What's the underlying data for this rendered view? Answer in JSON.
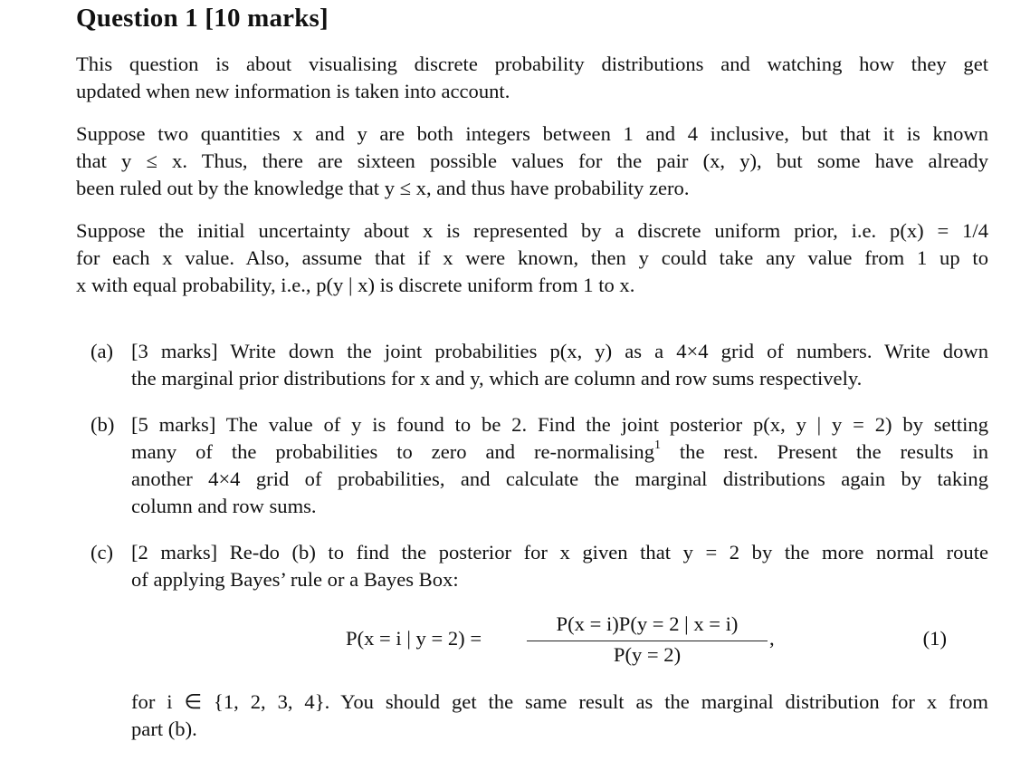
{
  "title": "Question 1 [10 marks]",
  "intro": {
    "lines": [
      "This question is about visualising discrete probability distributions and watching how they get",
      "updated when new information is taken into account."
    ]
  },
  "setup": {
    "lines": [
      "Suppose two quantities x and y are both integers between 1 and 4 inclusive, but that it is known",
      "that y ≤ x. Thus, there are sixteen possible values for the pair (x, y), but some have already",
      "been ruled out by the knowledge that y ≤ x, and thus have probability zero."
    ]
  },
  "prior": {
    "lines": [
      "Suppose the initial uncertainty about x is represented by a discrete uniform prior, i.e. p(x) = 1/4",
      "for each x value. Also, assume that if x were known, then y could take any value from 1 up to",
      "x with equal probability, i.e., p(y | x) is discrete uniform from 1 to x."
    ]
  },
  "parts": [
    {
      "label": "(a)",
      "marks": "[3 marks]",
      "lines": [
        "[3 marks] Write down the joint probabilities p(x, y) as a 4×4 grid of numbers. Write down",
        "the marginal prior distributions for x and y, which are column and row sums respectively."
      ]
    },
    {
      "label": "(b)",
      "marks": "[5 marks]",
      "lines": [
        "[5 marks] The value of y is found to be 2. Find the joint posterior p(x, y | y = 2) by setting",
        "many of the probabilities to zero and re-normalising",
        "the rest. Present the results in",
        "another 4×4 grid of probabilities, and calculate the marginal distributions again by taking",
        "column and row sums."
      ],
      "footnote_mark": "1"
    },
    {
      "label": "(c)",
      "marks": "[2 marks]",
      "lines": [
        "[2 marks] Re-do (b) to find the posterior for x given that y = 2 by the more normal route",
        "of applying Bayes’ rule or a Bayes Box:"
      ],
      "equation": {
        "lhs": "P(x = i | y = 2) =",
        "numerator": "P(x = i)P(y = 2 | x = i)",
        "denominator": "P(y = 2)",
        "trailing": ",",
        "number": "(1)"
      },
      "after_lines": [
        "for i ∈ {1, 2, 3, 4}. You should get the same result as the marginal distribution for x from",
        "part (b)."
      ]
    }
  ]
}
